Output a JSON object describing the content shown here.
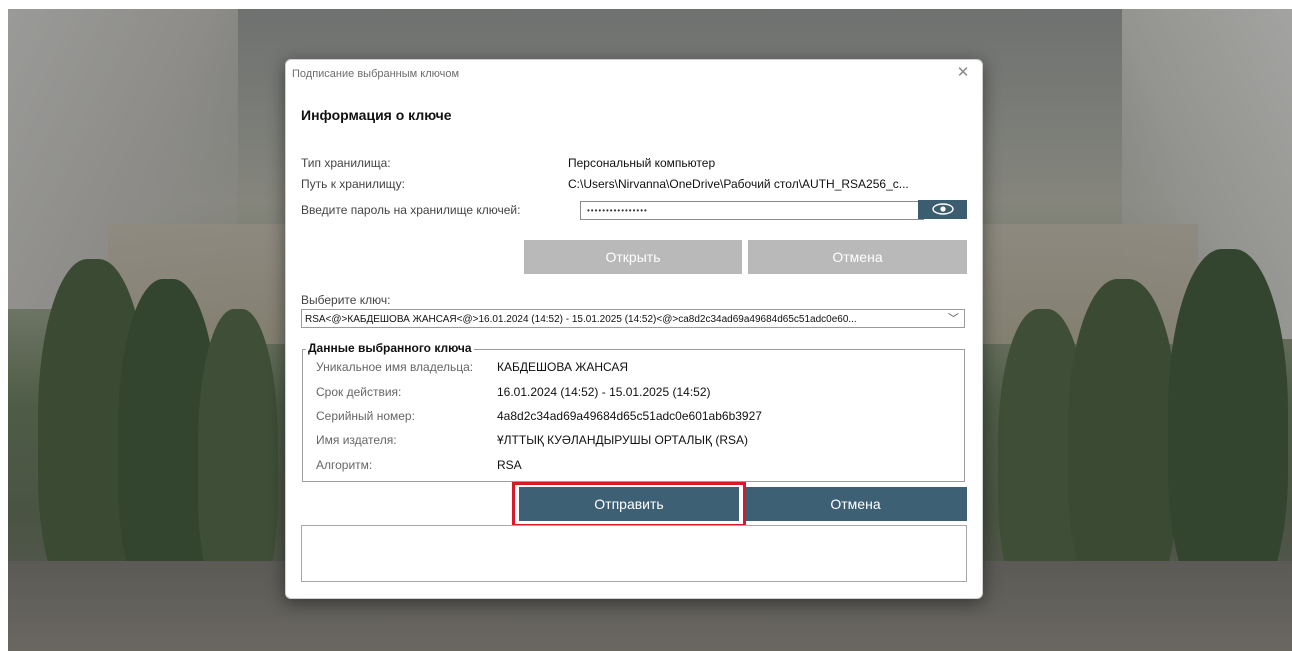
{
  "dialog": {
    "title": "Подписание выбранным ключом",
    "close_icon": "close-icon",
    "heading": "Информация о ключе",
    "storage_type_label": "Тип хранилища:",
    "storage_type_value": "Персональный компьютер",
    "storage_path_label": "Путь к хранилищу:",
    "storage_path_value": "C:\\Users\\Nirvanna\\OneDrive\\Рабочий стол\\AUTH_RSA256_c...",
    "password_label": "Введите пароль на хранилище ключей:",
    "password_value": "••••••••••••••••",
    "show_password_icon": "eye-icon",
    "open_button": "Открыть",
    "cancel_button_top": "Отмена",
    "select_key_label": "Выберите ключ:",
    "selected_key": "RSA<@>КАБДЕШОВА ЖАНСАЯ<@>16.01.2024 (14:52) - 15.01.2025 (14:52)<@>ca8d2c34ad69a49684d65c51adc0e60...",
    "dropdown_icon": "chevron-down-icon",
    "key_data": {
      "legend": "Данные выбранного ключа",
      "owner_label": "Уникальное имя владельца:",
      "owner_value": "КАБДЕШОВА ЖАНСАЯ",
      "validity_label": "Срок действия:",
      "validity_value": "16.01.2024 (14:52) - 15.01.2025 (14:52)",
      "serial_label": "Серийный номер:",
      "serial_value": "4a8d2c34ad69a49684d65c51adc0e601ab6b3927",
      "issuer_label": "Имя издателя:",
      "issuer_value": "ҰЛТТЫҚ КУӘЛАНДЫРУШЫ ОРТАЛЫҚ (RSA)",
      "algorithm_label": "Алгоритм:",
      "algorithm_value": "RSA"
    },
    "send_button": "Отправить",
    "cancel_button_bottom": "Отмена",
    "message_text": ""
  },
  "colors": {
    "primary_button": "#3d6075",
    "disabled_button": "#b9b9b9",
    "highlight": "#d8192b"
  }
}
